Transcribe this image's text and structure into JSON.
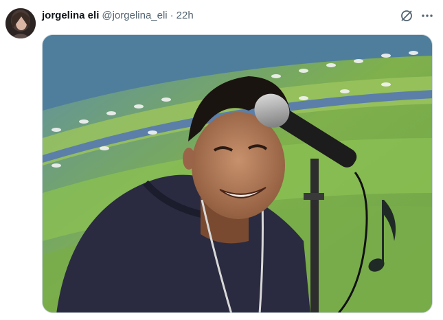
{
  "tweet": {
    "author": {
      "display_name": "jorgelina eli",
      "handle": "@jorgelina_eli"
    },
    "separator": "·",
    "time": "22h",
    "icons": {
      "grok": "grok-icon",
      "more": "more-icon"
    },
    "media": {
      "kind": "photo"
    }
  },
  "colors": {
    "text_primary": "#0f1419",
    "text_secondary": "#536471",
    "border": "#cfd9de"
  }
}
